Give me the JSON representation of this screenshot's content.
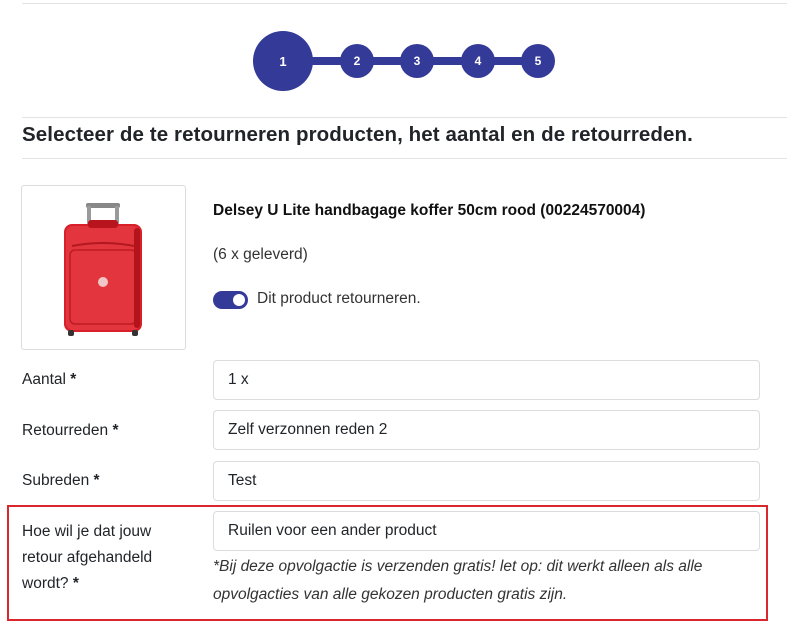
{
  "stepper": {
    "steps": [
      "1",
      "2",
      "3",
      "4",
      "5"
    ],
    "active_step": 1,
    "accent_color": "#343a97"
  },
  "heading": "Selecteer de te retourneren producten, het aantal en de retourreden.",
  "product": {
    "title": "Delsey U Lite handbagage koffer 50cm rood (00224570004)",
    "delivered": "(6 x geleverd)",
    "return_toggle_label": "Dit product retourneren.",
    "return_toggle_on": true,
    "image_icon": "red-suitcase-image"
  },
  "form": {
    "quantity": {
      "label": "Aantal",
      "required": "*",
      "value": "1 x"
    },
    "reason": {
      "label": "Retourreden",
      "required": "*",
      "value": "Zelf verzonnen reden 2"
    },
    "subreason": {
      "label": "Subreden",
      "required": "*",
      "value": "Test"
    },
    "handling": {
      "label": "Hoe wil je dat jouw retour afgehandeld wordt?",
      "required": "*",
      "value": "Ruilen voor een ander product",
      "note": "*Bij deze opvolgactie is verzenden gratis! let op: dit werkt alleen als alle opvolgacties van alle gekozen producten gratis zijn."
    }
  },
  "colors": {
    "highlight_border": "#d9262f"
  }
}
